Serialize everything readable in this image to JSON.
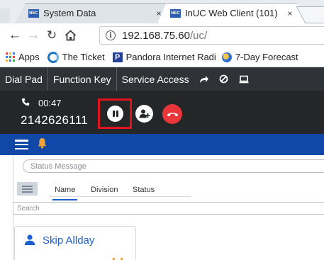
{
  "browser": {
    "tabs": [
      {
        "favicon_text": "NEC",
        "title": "System Data",
        "close": "×"
      },
      {
        "favicon_text": "NEC",
        "title": "InUC Web Client (101)",
        "close": "×"
      }
    ],
    "address": {
      "info": "i",
      "host": "192.168.75.60",
      "path": "/uc/"
    },
    "bookmarks": [
      {
        "label": "Apps"
      },
      {
        "label": "The Ticket"
      },
      {
        "label": "Pandora Internet Radi",
        "icon_text": "P"
      },
      {
        "label": "7-Day Forecast"
      }
    ]
  },
  "app_nav": {
    "items": [
      "Dial Pad",
      "Function Key",
      "Service Access"
    ],
    "icons": [
      "forward-icon",
      "block-icon",
      "monitor-icon"
    ]
  },
  "call": {
    "duration": "00:47",
    "number": "2142626111",
    "highlight_color": "#e0141c",
    "end_color": "#e8363a"
  },
  "status": {
    "placeholder": "Status Message"
  },
  "columns": {
    "tabs": [
      "Name",
      "Division",
      "Status"
    ],
    "active": "Name"
  },
  "search": {
    "placeholder": "Search"
  },
  "contacts": [
    {
      "name": "Skip Allday",
      "presence_color": "#f0a33b"
    }
  ],
  "colors": {
    "nav_bg": "#2f3236",
    "call_bg": "#242628",
    "blue_bar": "#1148a8",
    "accent": "#1c5fd1",
    "bell": "#f0a33b"
  }
}
